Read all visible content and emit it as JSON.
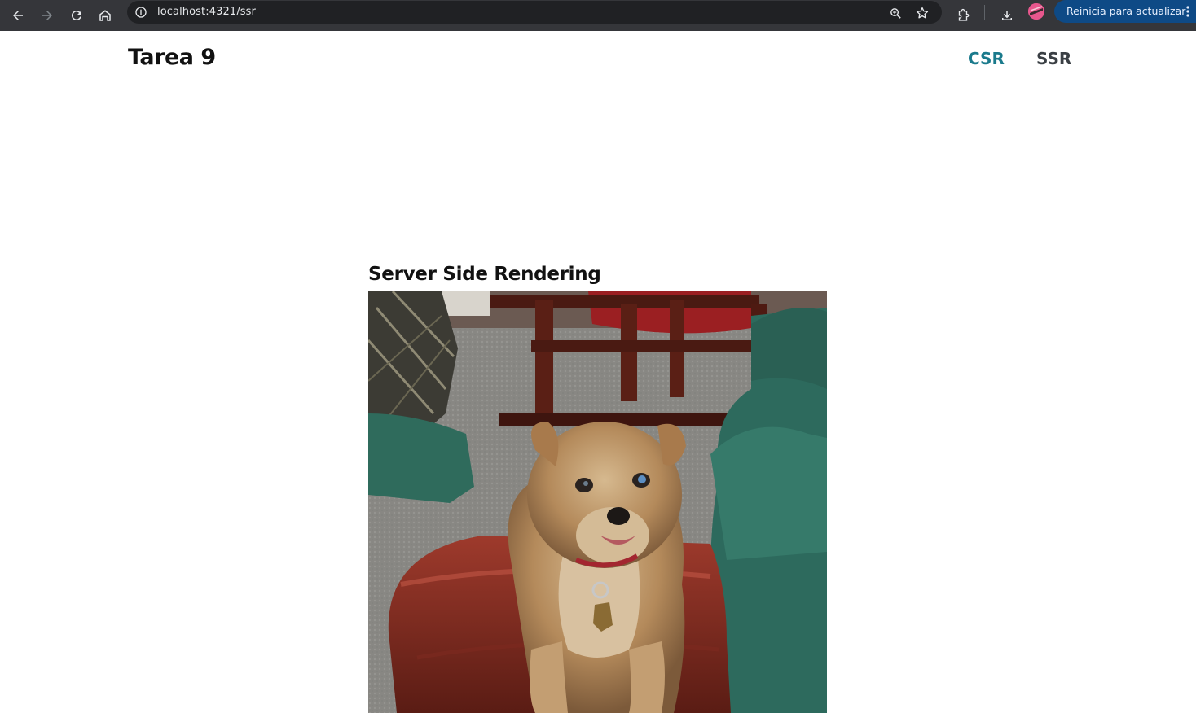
{
  "browser": {
    "url": "localhost:4321/ssr",
    "update_button_label": "Reinicia para actualizar",
    "icons": {
      "back": "arrow-left-icon",
      "forward": "arrow-right-icon",
      "reload": "reload-icon",
      "home": "home-icon",
      "site_info": "info-icon",
      "zoom": "zoom-icon",
      "bookmark": "star-icon",
      "extensions": "puzzle-icon",
      "downloads": "download-icon",
      "profile": "avatar",
      "menu": "kebab-menu-icon"
    }
  },
  "header": {
    "title": "Tarea 9",
    "nav": [
      {
        "label": "CSR",
        "active": true
      },
      {
        "label": "SSR",
        "active": false
      }
    ]
  },
  "main": {
    "heading": "Server Side Rendering",
    "image_subject": "small terrier dog sitting on a red cushion"
  },
  "colors": {
    "toolbar_bg": "#35363a",
    "omnibox_bg": "#202124",
    "update_pill": "#0e4a86",
    "nav_active": "#1a7a8c",
    "nav_inactive": "#3a3f44"
  }
}
